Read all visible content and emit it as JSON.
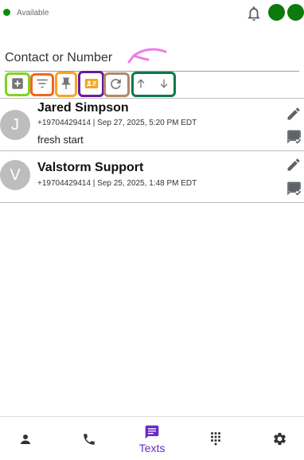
{
  "header": {
    "status_text": "Available",
    "status_color": "#0b8a0b",
    "icons": [
      "bell-icon",
      "profile-circle",
      "profile-circle"
    ]
  },
  "search": {
    "placeholder": "Contact or Number"
  },
  "toolbar": {
    "buttons": [
      "add-icon",
      "filter-icon",
      "pin-icon",
      "contact-card-icon",
      "refresh-icon",
      "arrow-up-icon",
      "arrow-down-icon"
    ],
    "highlight_colors": [
      "#7ed321",
      "#f5651f",
      "#f5a623",
      "#6a1b9a",
      "#b08968",
      "#0b7a4b"
    ]
  },
  "conversations": [
    {
      "initial": "J",
      "name": "Jared Simpson",
      "meta": "+19704429414 | Sep 27, 2025, 5:20 PM EDT",
      "preview": "fresh start"
    },
    {
      "initial": "V",
      "name": "Valstorm Support",
      "meta": "+19704429414 | Sep 25, 2025, 1:48 PM EDT",
      "preview": ""
    }
  ],
  "nav": {
    "items": [
      "person-icon",
      "phone-icon",
      "texts-icon",
      "dialpad-icon",
      "settings-icon"
    ],
    "active_label": "Texts",
    "active_color": "#6a2bc5"
  }
}
